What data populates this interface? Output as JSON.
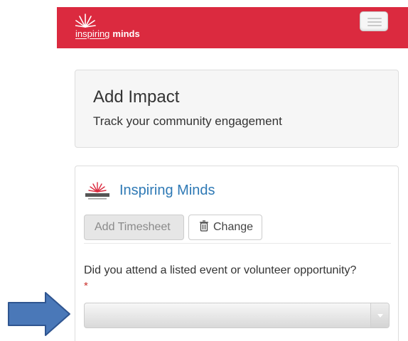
{
  "header": {
    "brand_light": "inspiring",
    "brand_bold": "minds",
    "brand_color": "#db2a3f"
  },
  "title_panel": {
    "title": "Add Impact",
    "subtitle": "Track your community engagement"
  },
  "form": {
    "org_name": "Inspiring Minds",
    "add_timesheet_label": "Add Timesheet",
    "change_label": "Change",
    "question": "Did you attend a listed event or volunteer opportunity?",
    "required_marker": "*",
    "select_value": ""
  },
  "icons": {
    "brand": "sunburst-logo-icon",
    "menu": "hamburger-menu-icon",
    "change": "trash-icon",
    "select": "chevron-down-icon",
    "annotation": "arrow-right-icon"
  },
  "colors": {
    "link_blue": "#2e79b5",
    "required_red": "#c9302c",
    "annotation_blue": "#4a78b8"
  }
}
